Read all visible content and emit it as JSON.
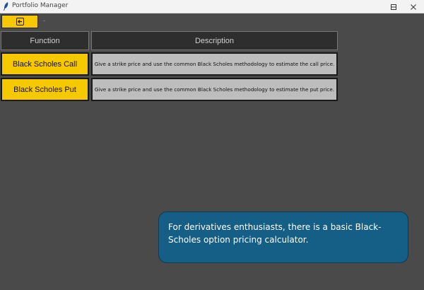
{
  "window": {
    "title": "Portfolio Manager",
    "controls": {
      "minimize": "—",
      "maximize": "☐",
      "close": "✕"
    }
  },
  "toolbar": {
    "back_icon": "back-arrow-icon",
    "status_text": "-"
  },
  "table": {
    "headers": [
      "Function",
      "Description"
    ],
    "rows": [
      {
        "function": "Black Scholes Call",
        "description": "Give a strike price and use the common Black Scholes methodology to estimate the call price."
      },
      {
        "function": "Black Scholes Put",
        "description": "Give a strike price and use the common Black Scholes methodology to estimate the put price."
      }
    ]
  },
  "callout": {
    "text": "For derivatives enthusiasts, there is a basic Black-Scholes option pricing calculator."
  },
  "colors": {
    "accent": "#f5c800",
    "background": "#4a4a4a",
    "header_bg": "#2e2e2e",
    "description_bg": "#bdbdbd",
    "callout_bg": "#155e85"
  }
}
